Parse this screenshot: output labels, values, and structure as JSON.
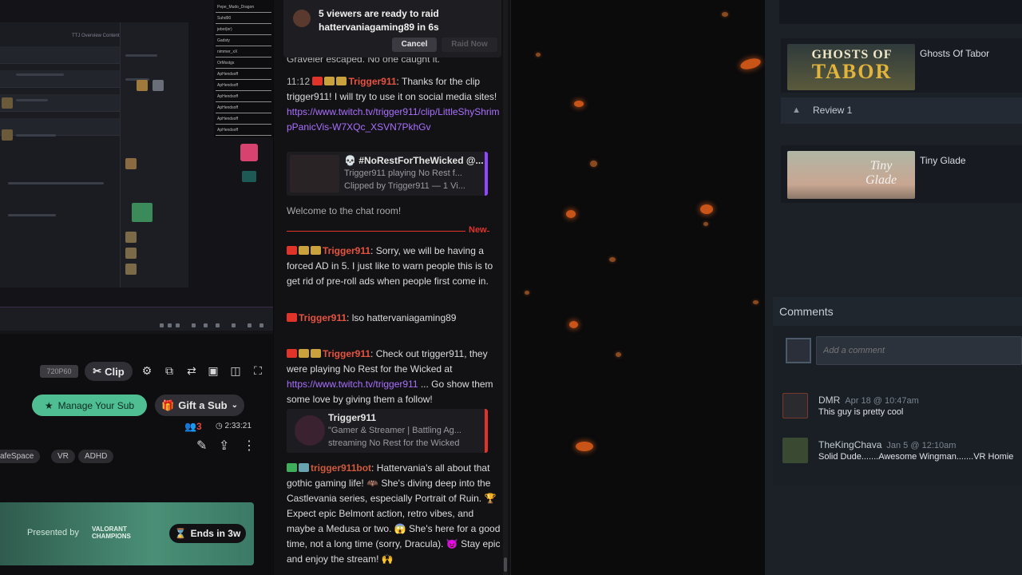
{
  "player": {
    "desktop_chat_items": [
      "Pepe_Mudo_Dragon",
      "Suhd90",
      "jebot(er)",
      "Gadsty",
      "nimmer_xX",
      "OrMsstgs",
      "ApHendsoff",
      "ApHendsoff",
      "ApHendsoff",
      "ApHendsoff",
      "ApHendsoff",
      "ApHendsoff"
    ],
    "quality": "720P60",
    "clip_label": "Clip",
    "manage_sub_label": "Manage Your Sub",
    "gift_sub_label": "Gift a Sub",
    "viewer_count": "3",
    "uptime": "2:33:21",
    "tags": [
      "afeSpace",
      "VR",
      "ADHD"
    ],
    "promo": {
      "presented_by": "Presented by",
      "logo_line1": "VALORANT",
      "logo_line2": "CHAMPIONS",
      "ends_label": "Ends in 3w"
    }
  },
  "chat": {
    "raid": {
      "text": "5 viewers are ready to raid hattervaniagaming89 in 6s",
      "cancel": "Cancel",
      "raid_now": "Raid Now"
    },
    "prev_message": "Graveler escaped. No one caught it.",
    "msg1": {
      "time": "11:12",
      "user": "Trigger911",
      "text": ": Thanks for the clip trigger911! I will try to use it on social media sites!",
      "link": "https://www.twitch.tv/trigger911/clip/LittleShyShrimpPanicVis-W7XQc_XSVN7PkhGv"
    },
    "clip_card": {
      "title": "💀 #NoRestForTheWicked @...",
      "line2": "Trigger911 playing No Rest f...",
      "line3": "Clipped by Trigger911 — 1 Vi..."
    },
    "welcome": "Welcome to the chat room!",
    "new_label": "New",
    "msg2": {
      "user": "Trigger911",
      "text": ": Sorry, we will be having a forced AD in 5. I just like to warn people this is to get rid of pre-roll ads when people first come in."
    },
    "msg3": {
      "user": "Trigger911",
      "text": ": lso hattervaniagaming89"
    },
    "msg4": {
      "user": "Trigger911",
      "text1": ": Check out trigger911, they were playing No Rest for the Wicked at ",
      "link": "https://www.twitch.tv/trigger911",
      "text2": " ... Go show them some love by giving them a follow!"
    },
    "profile_card": {
      "title": "Trigger911",
      "line2": "\"Gamer & Streamer | Battling Ag...",
      "line3": "streaming No Rest for the Wicked"
    },
    "msg5": {
      "user": "trigger911bot",
      "text": ": Hattervania's all about that gothic gaming life! 🦇 She's diving deep into the Castlevania series, especially Portrait of Ruin. 🏆 Expect epic Belmont action, retro vibes, and maybe a Medusa or two. 😱 She's here for a good time, not a long time (sorry, Dracula). 😈 Stay epic and enjoy the stream! 🙌"
    }
  },
  "steam": {
    "games": [
      {
        "name": "Ghosts Of Tabor",
        "logo1": "GHOSTS OF",
        "logo2": "TABOR"
      },
      {
        "name": "Tiny Glade",
        "logo1": "Tiny",
        "logo2": "Glade"
      }
    ],
    "review_label": "Review 1",
    "comments_title": "Comments",
    "comment_placeholder": "Add a comment",
    "comments": [
      {
        "name": "DMR",
        "date": "Apr 18 @ 10:47am",
        "text": "This guy is pretty cool"
      },
      {
        "name": "TheKingChava",
        "date": "Jan 5 @ 12:10am",
        "text": "Solid Dude.......Awesome Wingman.......VR Homie"
      }
    ]
  }
}
